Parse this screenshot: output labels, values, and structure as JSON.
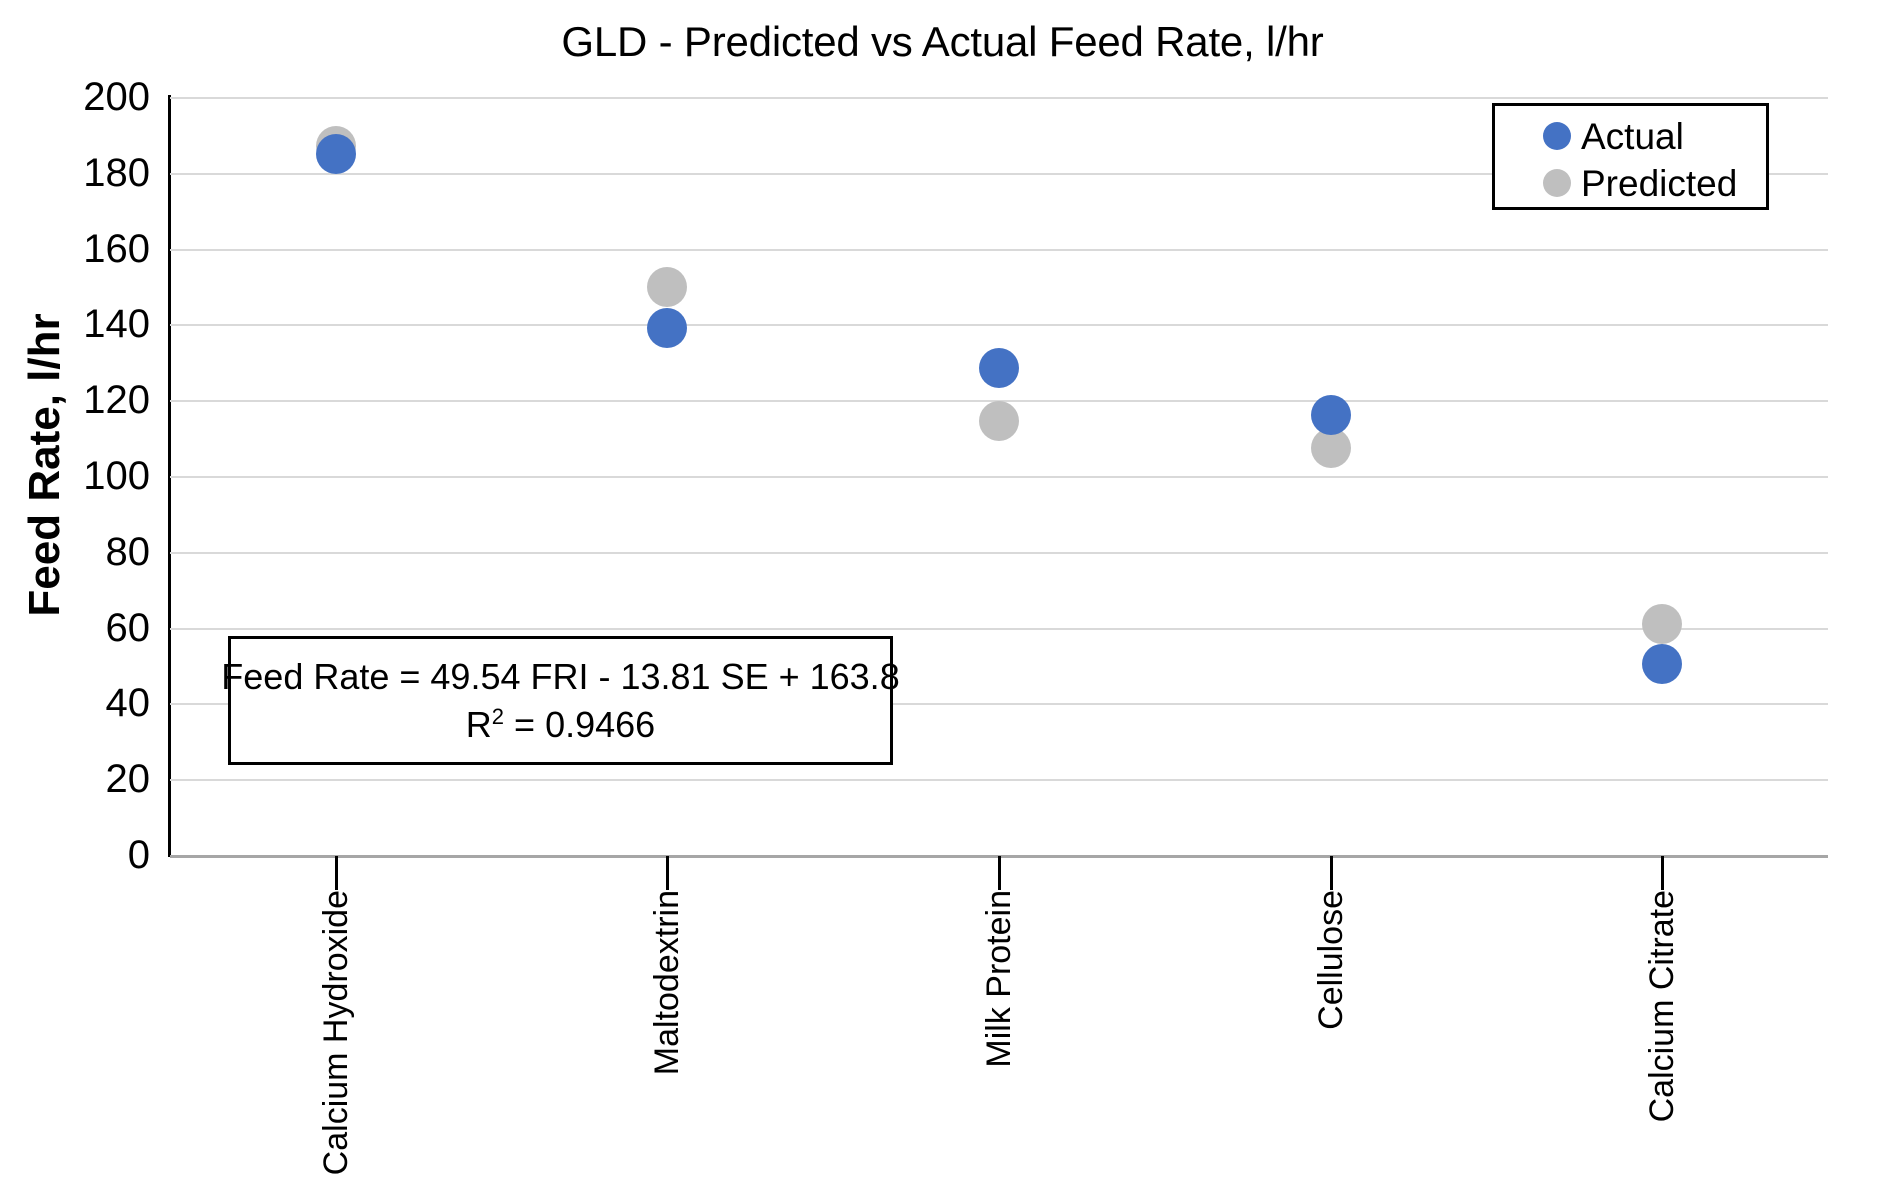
{
  "chart_data": {
    "type": "scatter",
    "title": "GLD - Predicted vs Actual Feed Rate, l/hr",
    "xlabel": "",
    "ylabel": "Feed Rate, l/hr",
    "categories": [
      "Calcium Hydroxide",
      "Maltodextrin",
      "Milk Protein",
      "Cellulose",
      "Calcium Citrate"
    ],
    "series": [
      {
        "name": "Actual",
        "color": "#4472C4",
        "values": [
          185,
          139,
          128.5,
          116,
          50.5
        ]
      },
      {
        "name": "Predicted",
        "color": "#BFBFBF",
        "values": [
          187,
          150,
          114.5,
          107.5,
          61
        ]
      }
    ],
    "ylim": [
      0,
      200
    ],
    "ytick_step": 20,
    "yticks": [
      200,
      180,
      160,
      140,
      120,
      100,
      80,
      60,
      40,
      20,
      0
    ],
    "ytick_labels": [
      "200",
      "180",
      "160",
      "140",
      "120",
      "100",
      "80",
      "60",
      "40",
      "20",
      "0"
    ],
    "grid": true,
    "grid_axis": "y",
    "legend_position": "top-right",
    "annotations": [
      {
        "line1": "Feed Rate = 49.54 FRI - 13.81 SE + 163.8",
        "line2_prefix": "R",
        "line2_sup": "2",
        "line2_suffix": " = 0.9466"
      }
    ]
  },
  "legend": {
    "entries": [
      {
        "label": "Actual"
      },
      {
        "label": "Predicted"
      }
    ]
  },
  "equation": {
    "line1": "Feed Rate = 49.54 FRI - 13.81 SE + 163.8",
    "r_symbol": "R",
    "r_exponent": "2",
    "r_value": " = 0.9466"
  }
}
